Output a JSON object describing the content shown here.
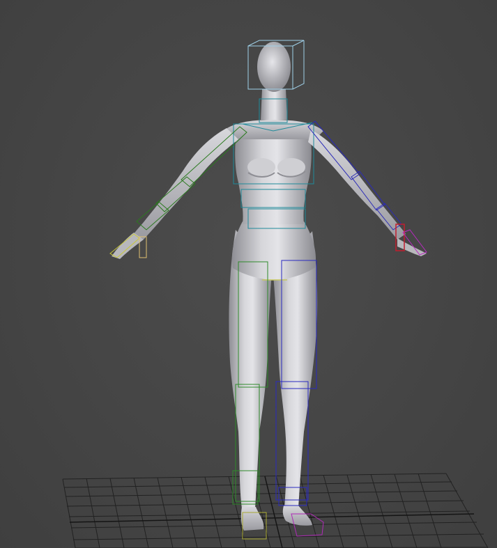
{
  "viewport": {
    "background_color": "#464646",
    "grid_color": "#1a1a1a",
    "mesh_color": "#c8c8cc"
  },
  "scene": {
    "object": "female-figure-mesh",
    "rig": "biped-skeleton",
    "pose": "A-pose",
    "bone_colors": {
      "head": "#9fd0e8",
      "spine": "#1f8a9a",
      "left_arm": "#2b7a1f",
      "right_arm": "#2a2ab8",
      "left_hand": "#c9c93a",
      "right_hand": "#c21e2e",
      "right_fingers": "#b82ac0",
      "left_leg": "#2e8a2a",
      "right_leg": "#2a2ac0",
      "left_foot": "#a8a832",
      "right_foot": "#b02ab8",
      "pelvis": "#c8c860"
    }
  }
}
